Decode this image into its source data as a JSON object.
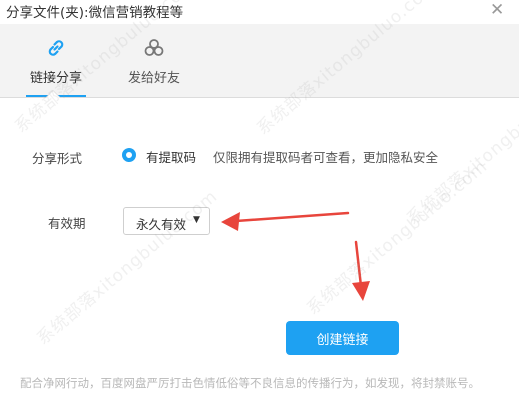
{
  "window": {
    "title": "分享文件(夹):微信营销教程等",
    "close_glyph": "✕"
  },
  "tabs": [
    {
      "label": "链接分享",
      "icon": "link-icon",
      "active": true
    },
    {
      "label": "发给好友",
      "icon": "friends-icon",
      "active": false
    }
  ],
  "form": {
    "share_type_label": "分享形式",
    "share_type_option": "有提取码",
    "share_type_desc": "仅限拥有提取码者可查看，更加隐私安全",
    "validity_label": "有效期",
    "validity_value": "永久有效"
  },
  "actions": {
    "create_label": "创建链接"
  },
  "footer": {
    "note": "配合净网行动，百度网盘严厉打击色情低俗等不良信息的传播行为，如发现，将封禁账号。"
  },
  "watermark": {
    "text": "系统部落xitongbuluo.com"
  },
  "annotations": {
    "arrow_color": "#e8453c"
  },
  "colors": {
    "accent": "#1ea1f2",
    "tab_bg": "#f3f3f3"
  }
}
